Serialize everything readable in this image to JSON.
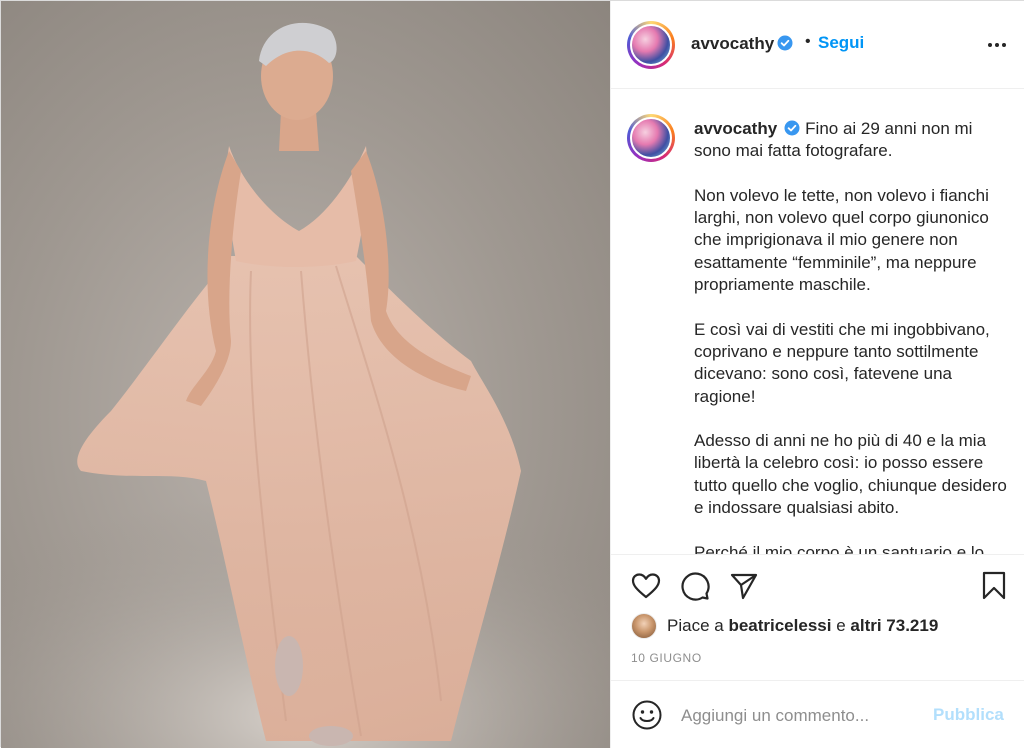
{
  "post": {
    "username": "avvocathy",
    "follow_label": "Segui",
    "dot": "•",
    "more_icon": "more-horizontal-icon",
    "verified_color": "#3897f0",
    "accent": "#0095f6"
  },
  "caption": {
    "username": "avvocathy",
    "paragraphs": [
      "Fino ai 29 anni non mi sono mai fatta fotografare.",
      "Non volevo le tette, non volevo i fianchi larghi, non volevo quel corpo giunonico che imprigionava il mio genere non esattamente “femminile”, ma neppure propriamente maschile.",
      "E così vai di vestiti che mi ingobbivano, coprivano e neppure tanto sottilmente dicevano: sono così, fatevene una ragione!",
      "Adesso di anni ne ho più di 40 e la mia libertà la celebro così: io posso essere tutto quello che voglio, chiunque desidero e indossare qualsiasi abito.",
      "Perché il mio corpo è un santuario e lo"
    ]
  },
  "actions": {
    "like_icon": "heart-icon",
    "comment_icon": "comment-icon",
    "share_icon": "paper-plane-icon",
    "save_icon": "bookmark-icon"
  },
  "likes": {
    "prefix": "Piace a",
    "user": "beatricelessi",
    "middle": "e",
    "others": "altri 73.219"
  },
  "date": "10 GIUGNO",
  "comment_box": {
    "emoji_icon": "emoji-icon",
    "placeholder": "Aggiungi un commento...",
    "publish_label": "Pubblica",
    "publish_color": "#b2dffc"
  }
}
